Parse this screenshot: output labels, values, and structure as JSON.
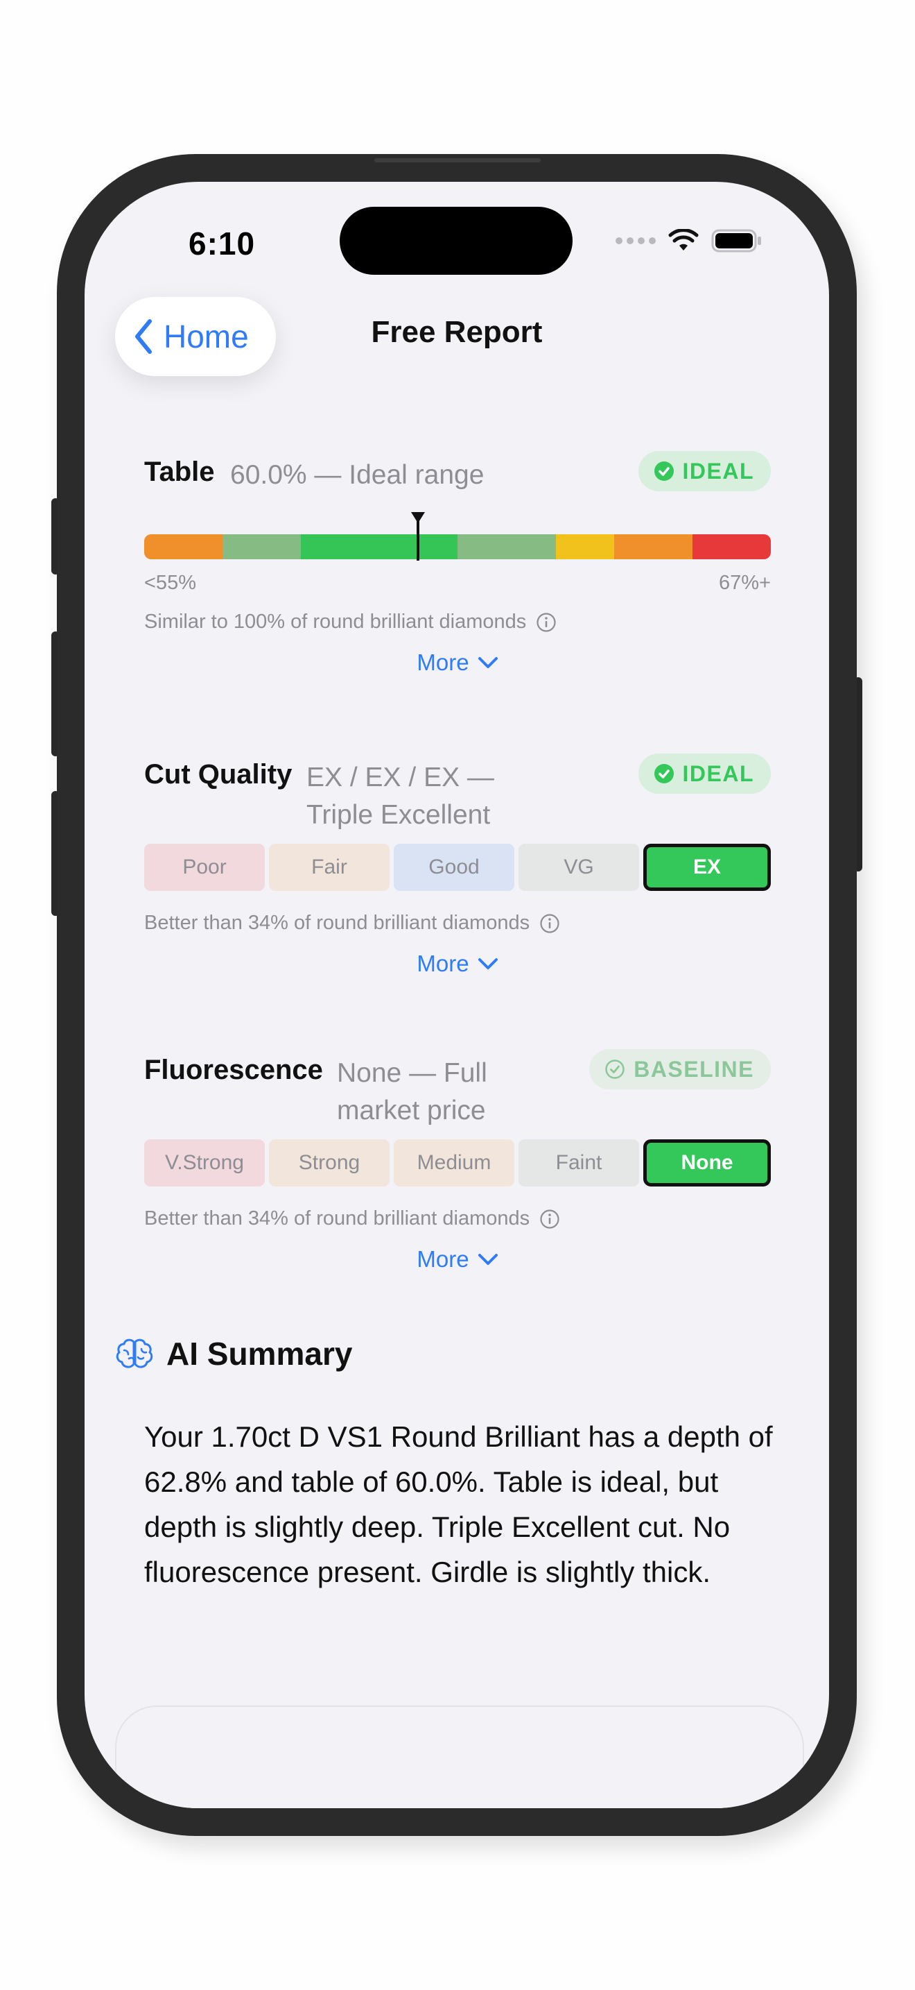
{
  "status_bar": {
    "time": "6:10"
  },
  "nav": {
    "back_label": "Home",
    "title": "Free Report"
  },
  "table": {
    "title": "Table",
    "value": "60.0% — Ideal range",
    "badge": "IDEAL",
    "scale_min_label": "<55%",
    "scale_max_label": "67%+",
    "marker_position": 0.437,
    "note": "Similar to 100% of round brilliant diamonds",
    "more_label": "More",
    "scale_colors": [
      "#f0902a",
      "#86bc84",
      "#35c557",
      "#86bc84",
      "#f2c21c",
      "#f0902a",
      "#e8393a"
    ]
  },
  "cut_quality": {
    "title": "Cut Quality",
    "value_line1": "EX / EX / EX —",
    "value_line2": "Triple Excellent",
    "badge": "IDEAL",
    "options": [
      "Poor",
      "Fair",
      "Good",
      "VG",
      "EX"
    ],
    "selected": "EX",
    "option_colors": [
      "#f2d9dd",
      "#f2e6dc",
      "#d9e3f4",
      "#e4e7e6",
      "#34c759"
    ],
    "note": "Better than 34% of round brilliant diamonds",
    "more_label": "More"
  },
  "fluorescence": {
    "title": "Fluorescence",
    "value_line1": "None — Full",
    "value_line2": "market price",
    "badge": "BASELINE",
    "options": [
      "V.Strong",
      "Strong",
      "Medium",
      "Faint",
      "None"
    ],
    "selected": "None",
    "option_colors": [
      "#f2d9dd",
      "#f2e6dc",
      "#f2e6dc",
      "#e4e7e6",
      "#34c759"
    ],
    "note": "Better than 34% of round brilliant diamonds",
    "more_label": "More"
  },
  "ai_summary": {
    "title": "AI Summary",
    "icon": "brain-icon",
    "text": "Your 1.70ct D VS1 Round Brilliant has a depth of 62.8% and table of 60.0%. Table is ideal, but depth is slightly deep. Triple Excellent cut. No fluorescence present. Girdle is slightly thick."
  },
  "colors": {
    "accent": "#2f7cf6",
    "ideal_green": "#34c759",
    "background": "#f2f2f7"
  }
}
